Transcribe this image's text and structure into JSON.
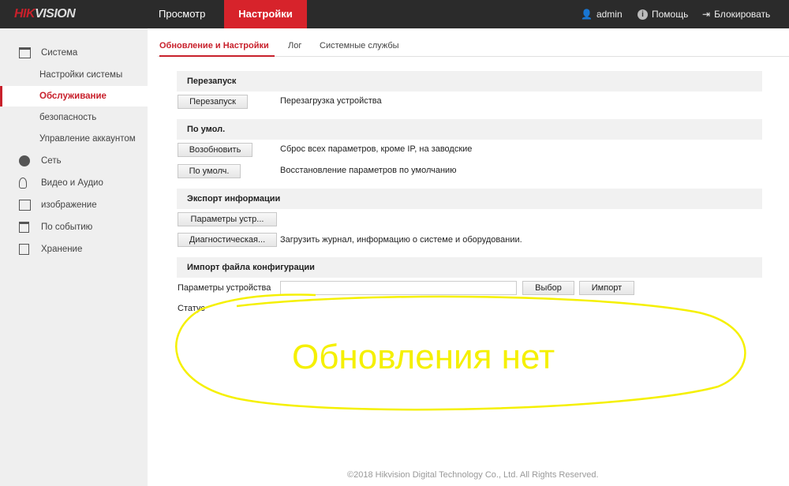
{
  "header": {
    "logo": "HIKVISION",
    "nav": [
      "Просмотр",
      "Настройки"
    ],
    "user": "admin",
    "help": "Помощь",
    "lock": "Блокировать"
  },
  "sidebar": {
    "items": [
      {
        "label": "Система",
        "icon": "system-icon"
      },
      {
        "label": "Настройки системы"
      },
      {
        "label": "Обслуживание",
        "active": true
      },
      {
        "label": "безопасность"
      },
      {
        "label": "Управление аккаунтом"
      },
      {
        "label": "Сеть",
        "icon": "globe-icon"
      },
      {
        "label": "Видео и Аудио",
        "icon": "video-audio-icon"
      },
      {
        "label": "изображение",
        "icon": "image-icon"
      },
      {
        "label": "По событию",
        "icon": "calendar-icon"
      },
      {
        "label": "Хранение",
        "icon": "storage-icon"
      }
    ]
  },
  "tabs": [
    "Обновление и Настройки",
    "Лог",
    "Системные службы"
  ],
  "sections": {
    "reboot": {
      "title": "Перезапуск",
      "button": "Перезапуск",
      "desc": "Перезагрузка устройства"
    },
    "defaults": {
      "title": "По умол.",
      "restore_button": "Возобновить",
      "restore_desc": "Сброс всех параметров, кроме IP, на заводские",
      "default_button": "По умолч.",
      "default_desc": "Восстановление параметров по умолчанию"
    },
    "export": {
      "title": "Экспорт информации",
      "params_button": "Параметры устр...",
      "diag_button": "Диагностическая...",
      "diag_desc": "Загрузить журнал, информацию о системе и оборудовании."
    },
    "import": {
      "title": "Импорт файла конфигурации",
      "label": "Параметры устройства",
      "value": "",
      "browse_button": "Выбор",
      "import_button": "Импорт",
      "status_label": "Статус"
    }
  },
  "annotation": {
    "text": "Обновления нет",
    "color": "#f5f000"
  },
  "footer": "©2018 Hikvision Digital Technology Co., Ltd. All Rights Reserved.",
  "colors": {
    "accent": "#d7232b",
    "topbar": "#2b2b2b"
  }
}
